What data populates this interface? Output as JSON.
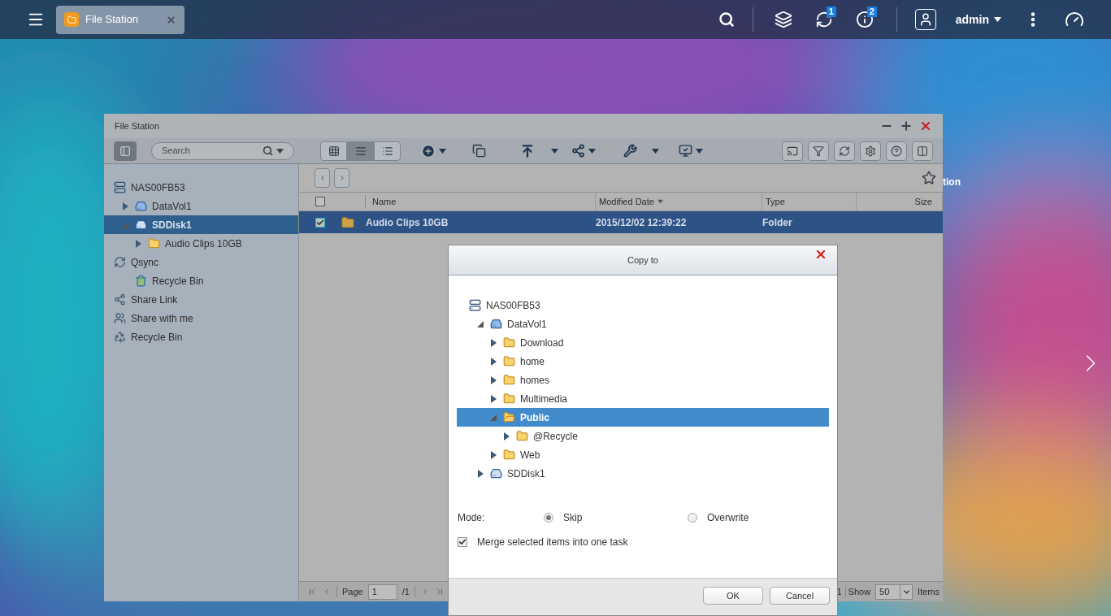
{
  "taskbar": {
    "tabs": [
      {
        "label": "File Station",
        "selected": true
      }
    ],
    "badges": [
      "1",
      "2"
    ],
    "user": "admin"
  },
  "desktop": {
    "icon_label": "tion"
  },
  "window": {
    "title": "File Station",
    "search": {
      "placeholder": "Search"
    },
    "view_modes": [
      {
        "kind": "thumbnails",
        "selected": false
      },
      {
        "kind": "list",
        "selected": true
      },
      {
        "kind": "details",
        "selected": false
      }
    ],
    "sidebar": {
      "items": [
        {
          "label": "NAS00FB53",
          "kind": "nas",
          "selected": false,
          "children": [
            {
              "label": "DataVol1",
              "kind": "volume",
              "selected": false,
              "expanded": false
            },
            {
              "label": "SDDisk1",
              "kind": "disk",
              "selected": true,
              "expanded": true,
              "children": [
                {
                  "label": "Audio Clips 10GB",
                  "kind": "folder",
                  "selected": false,
                  "expanded": false
                }
              ]
            }
          ]
        },
        {
          "label": "Qsync",
          "kind": "qsync",
          "selected": false,
          "children": [
            {
              "label": "Recycle Bin",
              "kind": "trash",
              "selected": false
            }
          ]
        },
        {
          "label": "Share Link",
          "kind": "share",
          "selected": false
        },
        {
          "label": "Share with me",
          "kind": "shared",
          "selected": false
        },
        {
          "label": "Recycle Bin",
          "kind": "recycle",
          "selected": false
        }
      ]
    },
    "table": {
      "columns": [
        {
          "label": "Name",
          "sorted": false
        },
        {
          "label": "Modified Date",
          "sorted": true
        },
        {
          "label": "Type",
          "sorted": false
        },
        {
          "label": "Size",
          "sorted": false
        }
      ],
      "header_checked": false,
      "rows": [
        {
          "name": "Audio Clips 10GB",
          "modified": "2015/12/02 12:39:22",
          "type": "Folder",
          "selected": true,
          "checked": true
        }
      ]
    },
    "footer": {
      "page_label": "Page",
      "page_value": "1",
      "page_total": "/1",
      "count_fragment": "1",
      "show_label": "Show",
      "show_value": "50",
      "items_label": "Items"
    }
  },
  "dialog": {
    "title": "Copy to",
    "tree": [
      {
        "label": "NAS00FB53",
        "kind": "nas",
        "selected": false,
        "children": [
          {
            "label": "DataVol1",
            "kind": "volume",
            "selected": false,
            "expanded": true,
            "children": [
              {
                "label": "Download",
                "kind": "folder",
                "selected": false,
                "expanded": false
              },
              {
                "label": "home",
                "kind": "folder",
                "selected": false,
                "expanded": false
              },
              {
                "label": "homes",
                "kind": "folder",
                "selected": false,
                "expanded": false
              },
              {
                "label": "Multimedia",
                "kind": "folder",
                "selected": false,
                "expanded": false
              },
              {
                "label": "Public",
                "kind": "folder",
                "selected": true,
                "expanded": true,
                "children": [
                  {
                    "label": "@Recycle",
                    "kind": "folder",
                    "selected": false,
                    "expanded": false
                  }
                ]
              },
              {
                "label": "Web",
                "kind": "folder",
                "selected": false,
                "expanded": false
              }
            ]
          },
          {
            "label": "SDDisk1",
            "kind": "disk",
            "selected": false,
            "expanded": false
          }
        ]
      }
    ],
    "mode_label": "Mode:",
    "modes": [
      {
        "label": "Skip",
        "selected": true
      },
      {
        "label": "Overwrite",
        "selected": false
      }
    ],
    "merge": {
      "label": "Merge selected items into one task",
      "checked": true
    },
    "buttons": [
      "OK",
      "Cancel"
    ]
  }
}
